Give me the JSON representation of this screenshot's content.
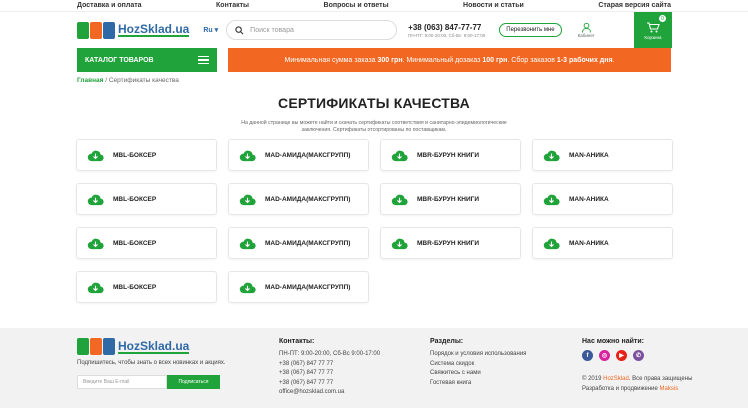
{
  "topbar": {
    "delivery": "Доставка и оплата",
    "contacts": "Контакты",
    "faq": "Вопросы и ответы",
    "news": "Новости и статьи",
    "old": "Старая версия сайта"
  },
  "header": {
    "logo": "HozSklad.ua",
    "lang": "Ru",
    "search_placeholder": "Поиск товара",
    "phone": "+38 (063) 847-77-77",
    "hours": "ПН-ПТ: 9:00-20:00, Сб-Вс: 9:00-17:00",
    "callback": "Перезвонить мне",
    "cabinet": "Кабинет",
    "cart": "Корзина",
    "cart_count": "0"
  },
  "nav": {
    "catalog": "КАТАЛОГ ТОВАРОВ",
    "promo_a": "Минимальная сумма заказа ",
    "promo_b": "300 грн",
    "promo_c": ". Минимальный дозаказ ",
    "promo_d": "100 грн",
    "promo_e": ". Сбор заказов ",
    "promo_f": "1-3 рабочих дня",
    "promo_g": "."
  },
  "breadcrumb": {
    "home": "Главная",
    "sep": " / ",
    "current": "Сертификаты качества"
  },
  "page": {
    "title": "СЕРТИФИКАТЫ КАЧЕСТВА",
    "intro": "На данной странице вы можете найти и скачать сертификаты соответствия и санитарно-эпидемиологические заключения. Сертификаты отсортированы по поставщикам."
  },
  "certs": [
    "MBL-БОКСЕР",
    "MAD-АМИДА(МАКСГРУПП)",
    "MBR-БУРУН КНИГИ",
    "MAN-АНИКА",
    "MBL-БОКСЕР",
    "MAD-АМИДА(МАКСГРУПП)",
    "MBR-БУРУН КНИГИ",
    "MAN-АНИКА",
    "MBL-БОКСЕР",
    "MAD-АМИДА(МАКСГРУПП)",
    "MBR-БУРУН КНИГИ",
    "MAN-АНИКА",
    "MBL-БОКСЕР",
    "MAD-АМИДА(МАКСГРУПП)"
  ],
  "footer": {
    "logo": "HozSklad.ua",
    "subscribe_text": "Подпишитесь, чтобы знать о всех новинках и акциях.",
    "email_placeholder": "Введите Ваш E-mail",
    "subscribe_btn": "Подписаться",
    "contacts_title": "Контакты:",
    "contacts": [
      "ПН-ПТ: 9:00-20:00, Сб-Вс 9:00-17:00",
      "+38 (067) 847 77 77",
      "+38 (067) 847 77 77",
      "+38 (067) 847 77 77",
      "office@hozsklad.com.ua"
    ],
    "sections_title": "Разделы:",
    "sections": [
      "Порядок и условия использования",
      "Система скидок",
      "Свяжитесь с нами",
      "Гостевая книга"
    ],
    "social_title": "Нас можно найти:",
    "copy_a": "© 2019 ",
    "copy_b": "HozSklad",
    "copy_c": ". Все права защищены",
    "copy_d": "Разработка и продвижение ",
    "copy_e": "Maksis"
  },
  "colors": {
    "green": "#1fa33a",
    "orange": "#f26722",
    "blue": "#2f6aa6"
  }
}
